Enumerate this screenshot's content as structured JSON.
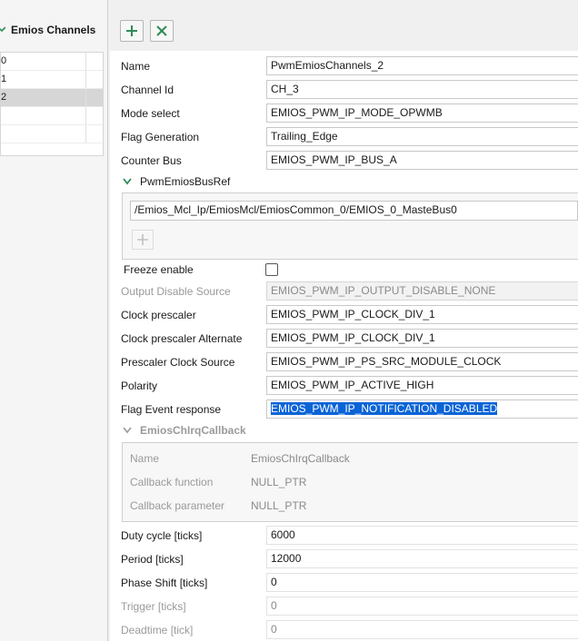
{
  "left_panel": {
    "title": "Emios Channels",
    "items": [
      {
        "label": "0",
        "selected": false
      },
      {
        "label": "1",
        "selected": false
      },
      {
        "label": "2",
        "selected": true
      }
    ]
  },
  "toolbar": {
    "add_icon": "plus-icon",
    "remove_icon": "close-icon"
  },
  "fields": {
    "name": {
      "label": "Name",
      "value": "PwmEmiosChannels_2"
    },
    "channel_id": {
      "label": "Channel Id",
      "value": "CH_3"
    },
    "mode_select": {
      "label": "Mode select",
      "value": "EMIOS_PWM_IP_MODE_OPWMB"
    },
    "flag_generation": {
      "label": "Flag Generation",
      "value": "Trailing_Edge"
    },
    "counter_bus": {
      "label": "Counter Bus",
      "value": "EMIOS_PWM_IP_BUS_A"
    },
    "bus_ref": {
      "label": "PwmEmiosBusRef",
      "value": "/Emios_Mcl_Ip/EmiosMcl/EmiosCommon_0/EMIOS_0_MasteBus0"
    },
    "freeze_enable": {
      "label": "Freeze enable",
      "checked": false
    },
    "output_disable_source": {
      "label": "Output Disable Source",
      "value": "EMIOS_PWM_IP_OUTPUT_DISABLE_NONE"
    },
    "clock_prescaler": {
      "label": "Clock prescaler",
      "value": "EMIOS_PWM_IP_CLOCK_DIV_1"
    },
    "clock_prescaler_alt": {
      "label": "Clock prescaler Alternate",
      "value": "EMIOS_PWM_IP_CLOCK_DIV_1"
    },
    "prescaler_clock_source": {
      "label": "Prescaler Clock Source",
      "value": "EMIOS_PWM_IP_PS_SRC_MODULE_CLOCK"
    },
    "polarity": {
      "label": "Polarity",
      "value": "EMIOS_PWM_IP_ACTIVE_HIGH"
    },
    "flag_event_response": {
      "label": "Flag Event response",
      "value": "EMIOS_PWM_IP_NOTIFICATION_DISABLED"
    }
  },
  "callback": {
    "header": "EmiosChIrqCallback",
    "name": {
      "label": "Name",
      "value": "EmiosChIrqCallback"
    },
    "function": {
      "label": "Callback function",
      "value": "NULL_PTR"
    },
    "parameter": {
      "label": "Callback parameter",
      "value": "NULL_PTR"
    }
  },
  "ticks": {
    "duty_cycle": {
      "label": "Duty cycle [ticks]",
      "value": "6000"
    },
    "period": {
      "label": "Period [ticks]",
      "value": "12000"
    },
    "phase_shift": {
      "label": "Phase Shift [ticks]",
      "value": "0"
    },
    "trigger": {
      "label": "Trigger [ticks]",
      "value": "0"
    },
    "deadtime": {
      "label": "Deadtime [tick]",
      "value": "0"
    }
  },
  "colors": {
    "selection": "#0a64d6",
    "accent_green": "#2e8b57"
  }
}
